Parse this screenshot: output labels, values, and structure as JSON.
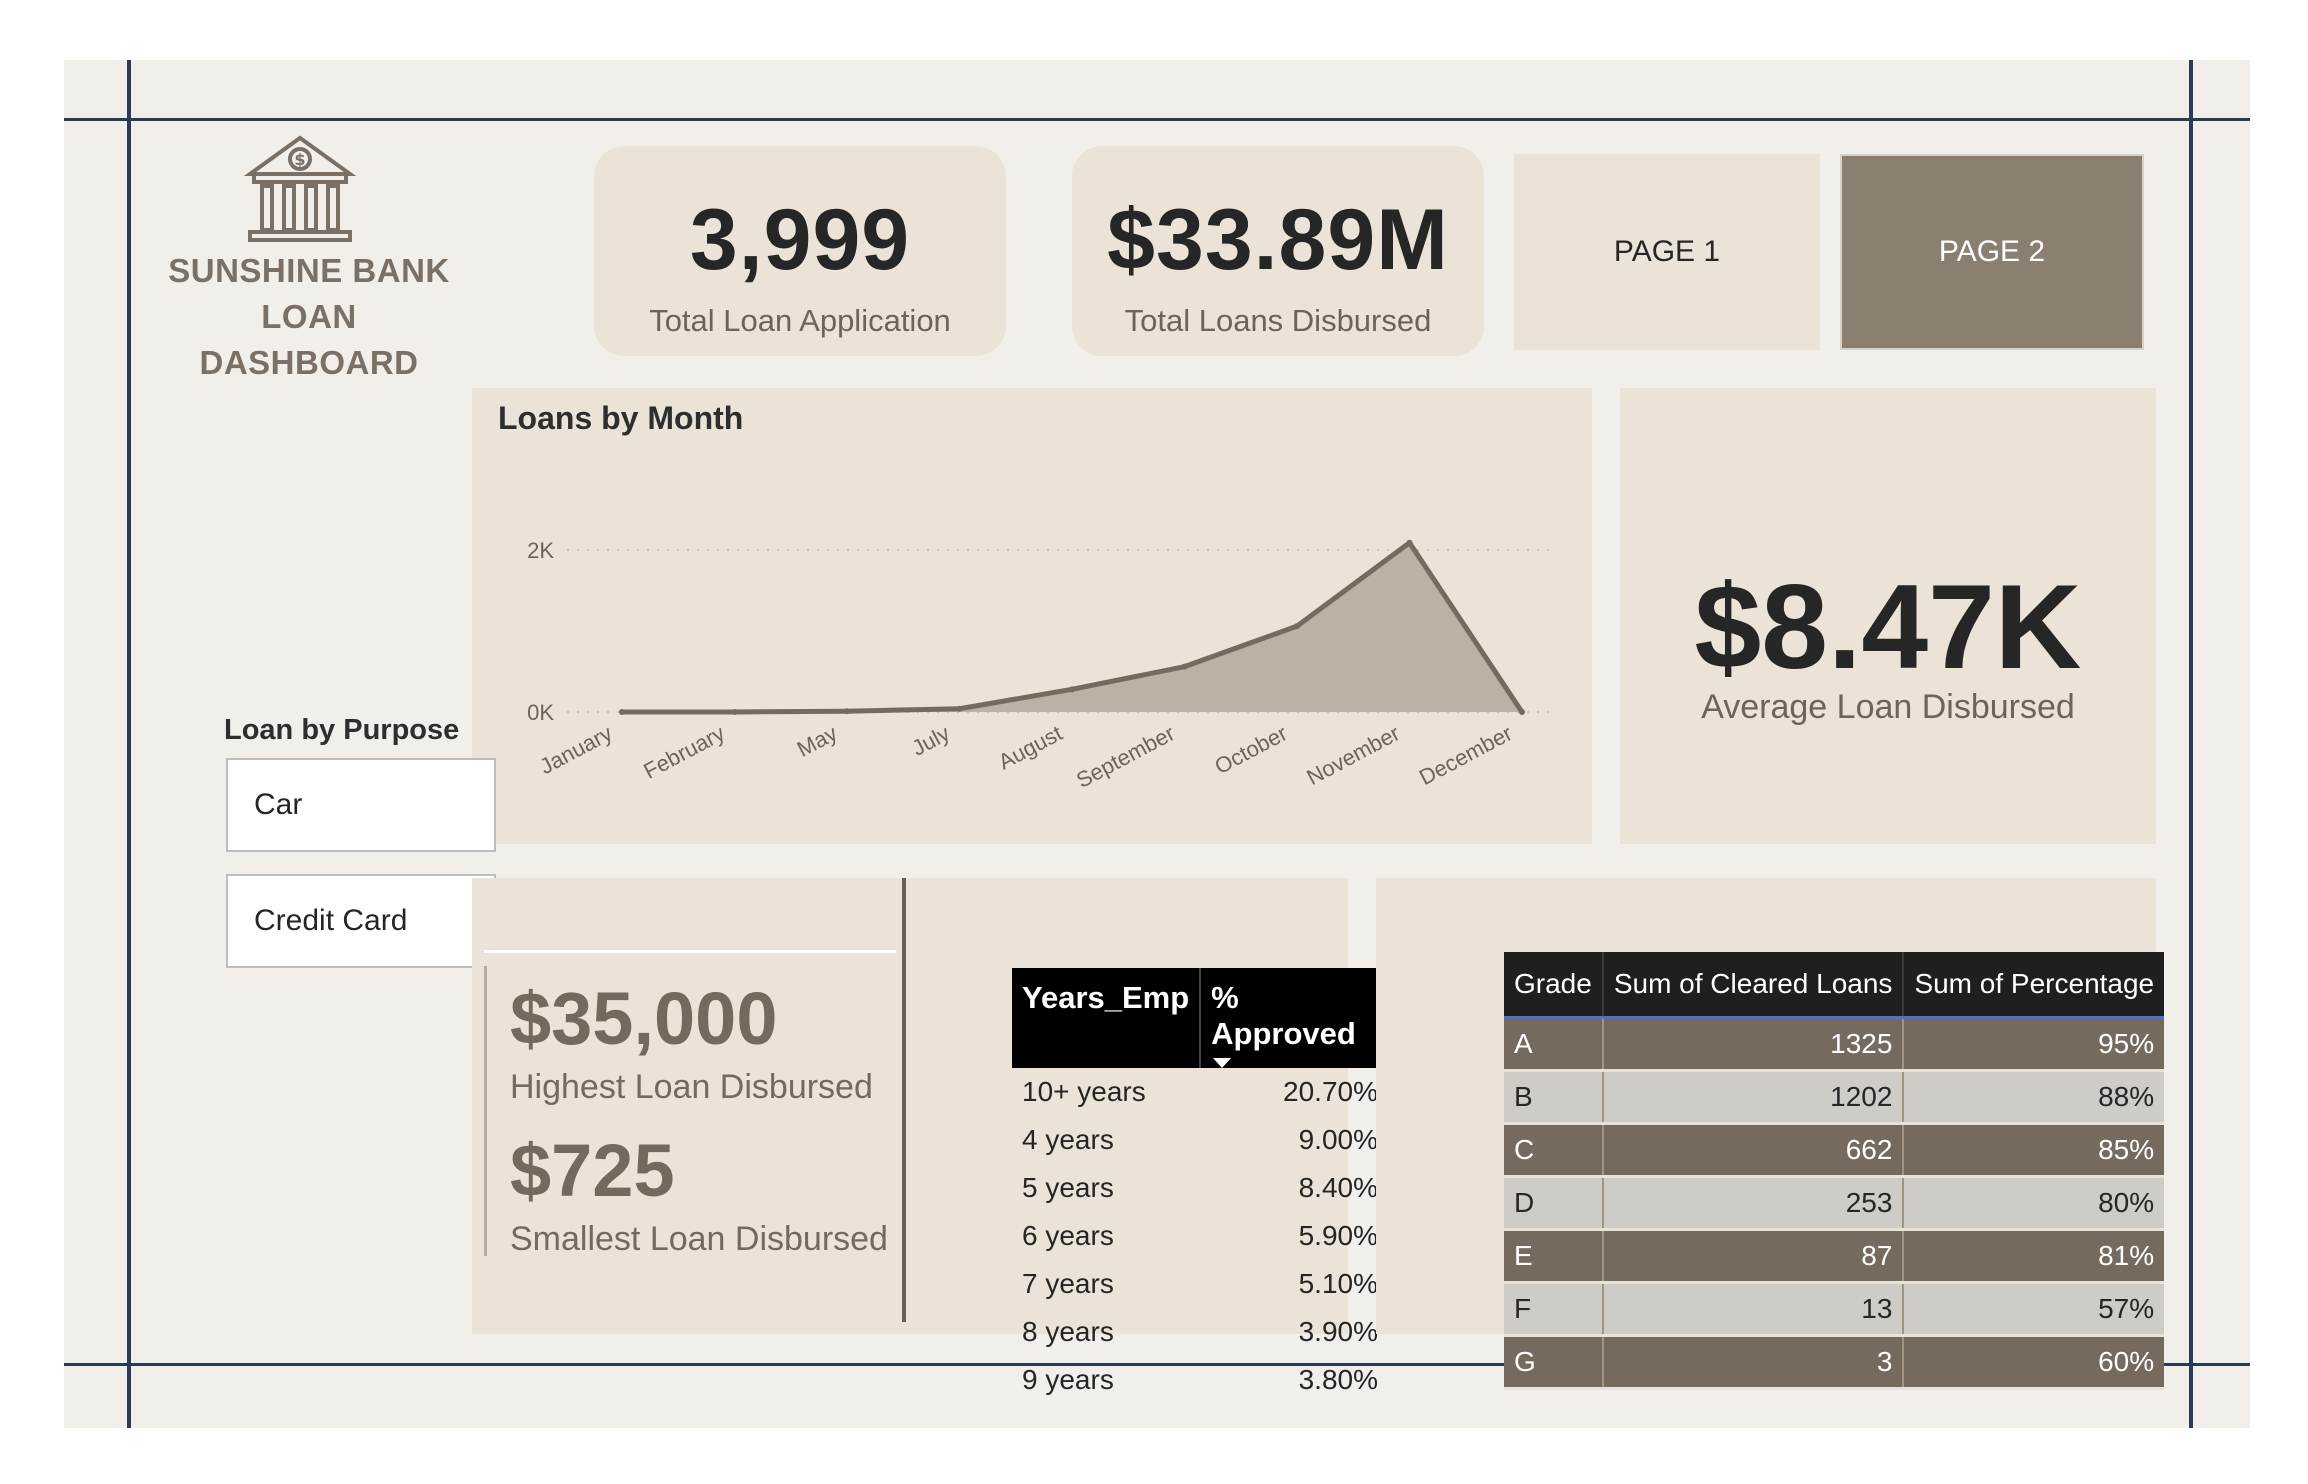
{
  "brand": {
    "title_lines": [
      "SUNSHINE BANK",
      "LOAN",
      "DASHBOARD"
    ],
    "logo_icon": "bank-building-icon"
  },
  "kpis": {
    "total_applications": {
      "value": "3,999",
      "label": "Total Loan Application"
    },
    "total_disbursed": {
      "value": "$33.89M",
      "label": "Total Loans Disbursed"
    },
    "average_disbursed": {
      "value": "$8.47K",
      "label": "Average Loan Disbursed"
    },
    "highest": {
      "value": "$35,000",
      "label": "Highest Loan Disbursed"
    },
    "smallest": {
      "value": "$725",
      "label": "Smallest Loan Disbursed"
    }
  },
  "nav": {
    "page1": "PAGE 1",
    "page2": "PAGE 2",
    "active": "PAGE 2"
  },
  "slicer": {
    "title": "Loan by Purpose",
    "items": [
      "Car",
      "Credit Card"
    ]
  },
  "chart": {
    "title": "Loans by Month"
  },
  "chart_data": {
    "type": "area",
    "title": "Loans by Month",
    "categories": [
      "January",
      "February",
      "May",
      "July",
      "August",
      "September",
      "October",
      "November",
      "December"
    ],
    "values": [
      0,
      0,
      10,
      40,
      280,
      560,
      1060,
      2090,
      0
    ],
    "y_ticks": [
      "0K",
      "2K"
    ],
    "ylim": [
      0,
      2000
    ],
    "grid": true,
    "fill_color": "#bbb1a4",
    "line_color": "#746a5e"
  },
  "years_table": {
    "headers": [
      "Years_Emp",
      "% Approved"
    ],
    "sort_icon": "sort-descending-icon",
    "rows": [
      [
        "10+ years",
        "20.70%"
      ],
      [
        "4 years",
        "9.00%"
      ],
      [
        "5 years",
        "8.40%"
      ],
      [
        "6 years",
        "5.90%"
      ],
      [
        "7 years",
        "5.10%"
      ],
      [
        "8 years",
        "3.90%"
      ],
      [
        "9 years",
        "3.80%"
      ]
    ]
  },
  "grade_table": {
    "headers": [
      "Grade",
      "Sum of Cleared Loans",
      "Sum of Percentage"
    ],
    "rows": [
      [
        "A",
        "1325",
        "95%"
      ],
      [
        "B",
        "1202",
        "88%"
      ],
      [
        "C",
        "662",
        "85%"
      ],
      [
        "D",
        "253",
        "80%"
      ],
      [
        "E",
        "87",
        "81%"
      ],
      [
        "F",
        "13",
        "57%"
      ],
      [
        "G",
        "3",
        "60%"
      ]
    ]
  },
  "colors": {
    "canvas": "#f2eeea",
    "card": "#ebe3d7",
    "accent_dark": "#746a5e",
    "nav_active": "#8a7f71",
    "frame_lines": "#2b3a55"
  }
}
